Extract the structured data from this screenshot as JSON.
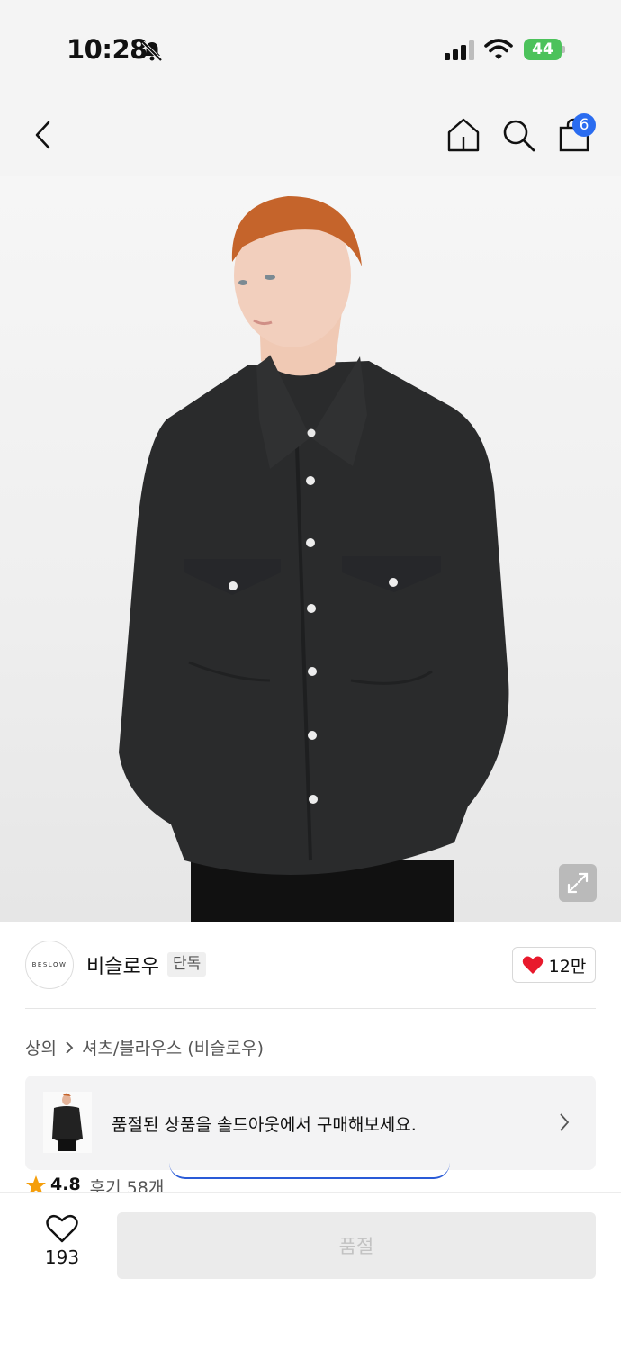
{
  "status_bar": {
    "time": "10:28",
    "battery": "44"
  },
  "header": {
    "cart_count": "6",
    "icons": [
      "back-icon",
      "home-icon",
      "search-icon",
      "shopping-bag-icon"
    ]
  },
  "brand": {
    "logo_text": "BESLOW",
    "name": "비슬로우",
    "badge": "단독",
    "like_count": "12만"
  },
  "breadcrumb": {
    "category": "상의",
    "subcategory": "셔츠/블라우스 (비슬로우)"
  },
  "soldout_banner": {
    "text": "품절된 상품을 솔드아웃에서 구매해보세요."
  },
  "rating": {
    "score": "4.8",
    "reviews": "후기 58개"
  },
  "bottom_bar": {
    "wish_count": "193",
    "cta_label": "품절"
  },
  "colors": {
    "accent": "#2a6cf0",
    "heart": "#e8192c",
    "star": "#f59e0b",
    "battery": "#4cc25b"
  }
}
